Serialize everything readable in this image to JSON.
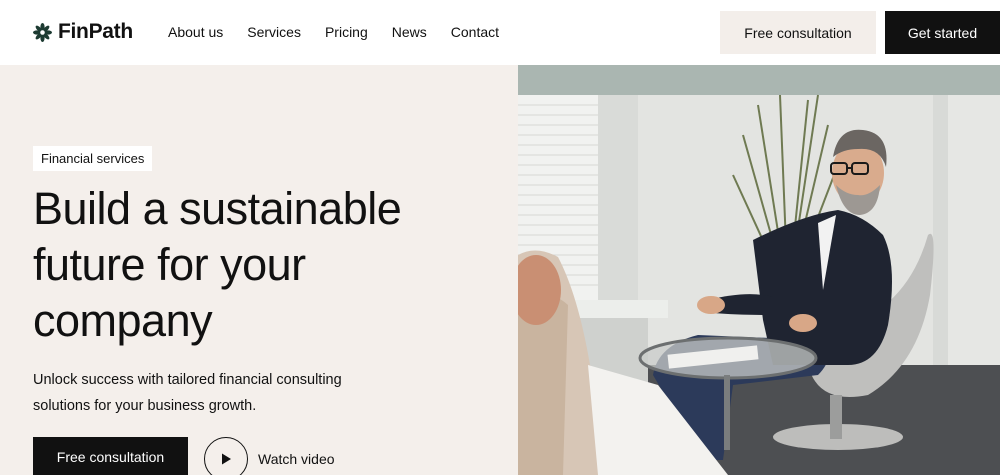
{
  "brand": {
    "name": "FinPath",
    "logo_icon": "asterisk-flower-icon"
  },
  "nav": {
    "items": [
      {
        "label": "About us"
      },
      {
        "label": "Services"
      },
      {
        "label": "Pricing"
      },
      {
        "label": "News"
      },
      {
        "label": "Contact"
      }
    ]
  },
  "header_actions": {
    "consult_label": "Free consultation",
    "start_label": "Get started"
  },
  "hero": {
    "badge": "Financial services",
    "title": "Build a sustainable future for your company",
    "subtitle": "Unlock success with tailored financial consulting solutions for your business growth.",
    "cta_label": "Free consultation",
    "video_label": "Watch video",
    "video_icon": "play-icon",
    "image_alt": "Businessman seated in an armchair during a consultation"
  },
  "colors": {
    "hero_bg": "#f4efeb",
    "primary": "#111111",
    "secondary_button": "#f3eeea"
  }
}
